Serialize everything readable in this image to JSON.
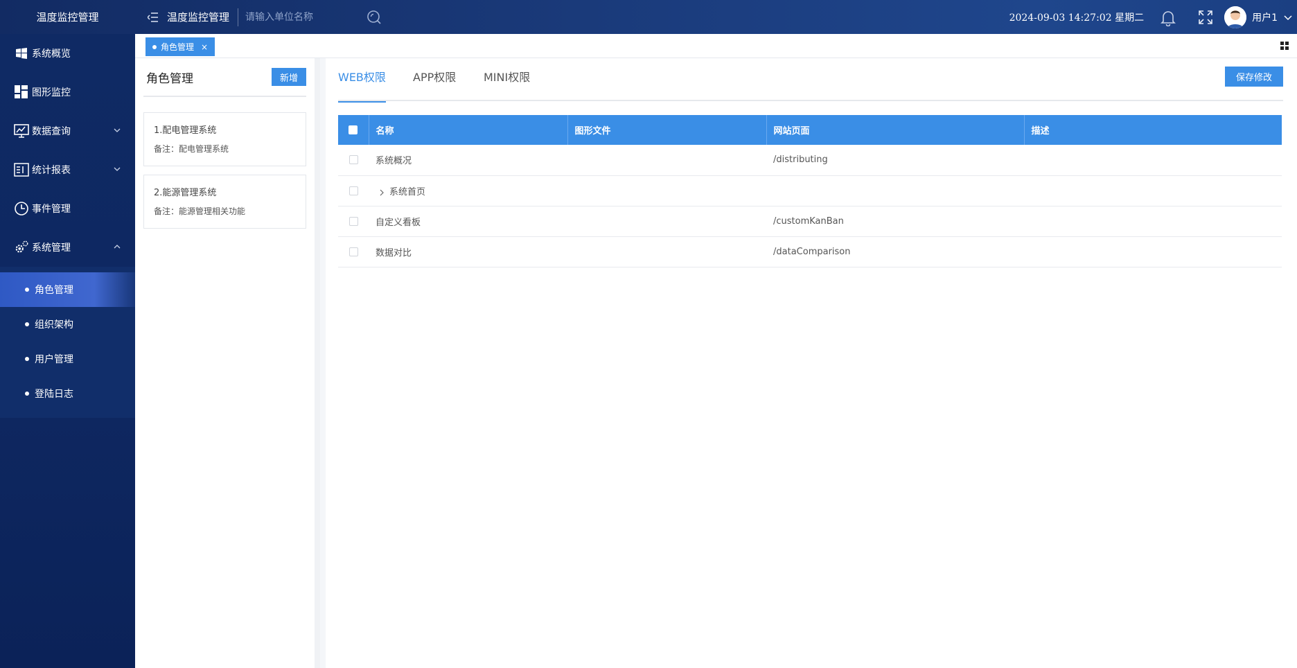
{
  "app": {
    "logo_text": "温度监控管理",
    "title": "温度监控管理"
  },
  "header": {
    "search_placeholder": "请输入单位名称",
    "datetime": "2024-09-03 14:27:02 星期二",
    "username": "用户1"
  },
  "sidebar": {
    "items": [
      {
        "label": "系统概览",
        "icon": "windows-icon"
      },
      {
        "label": "图形监控",
        "icon": "dashboard-grid-icon"
      },
      {
        "label": "数据查询",
        "icon": "monitor-icon",
        "expandable": true
      },
      {
        "label": "统计报表",
        "icon": "report-icon",
        "expandable": true
      },
      {
        "label": "事件管理",
        "icon": "clock-icon"
      },
      {
        "label": "系统管理",
        "icon": "gears-icon",
        "expanded": true
      }
    ],
    "subitems": [
      {
        "label": "角色管理",
        "active": true
      },
      {
        "label": "组织架构"
      },
      {
        "label": "用户管理"
      },
      {
        "label": "登陆日志"
      }
    ]
  },
  "tabs": {
    "open_tab": "角色管理",
    "close_glyph": "×"
  },
  "roles": {
    "title": "角色管理",
    "add_label": "新增",
    "list": [
      {
        "name": "1.配电管理系统",
        "note": "备注：配电管理系统"
      },
      {
        "name": "2.能源管理系统",
        "note": "备注：能源管理相关功能"
      }
    ]
  },
  "permissions": {
    "tabs": [
      "WEB权限",
      "APP权限",
      "MINI权限"
    ],
    "active_tab": "WEB权限",
    "save_label": "保存修改",
    "columns": [
      "名称",
      "图形文件",
      "网站页面",
      "描述"
    ],
    "rows": [
      {
        "name": "系统概况",
        "file": "",
        "page": "/distributing",
        "desc": ""
      },
      {
        "name": "系统首页",
        "file": "",
        "page": "",
        "desc": "",
        "expandable": true
      },
      {
        "name": "自定义看板",
        "file": "",
        "page": "/customKanBan",
        "desc": ""
      },
      {
        "name": "数据对比",
        "file": "",
        "page": "/dataComparison",
        "desc": ""
      }
    ]
  },
  "colors": {
    "accent": "#3a8ee6",
    "topbar": "#1a3a7a",
    "sidebar": "#0f2a64"
  }
}
